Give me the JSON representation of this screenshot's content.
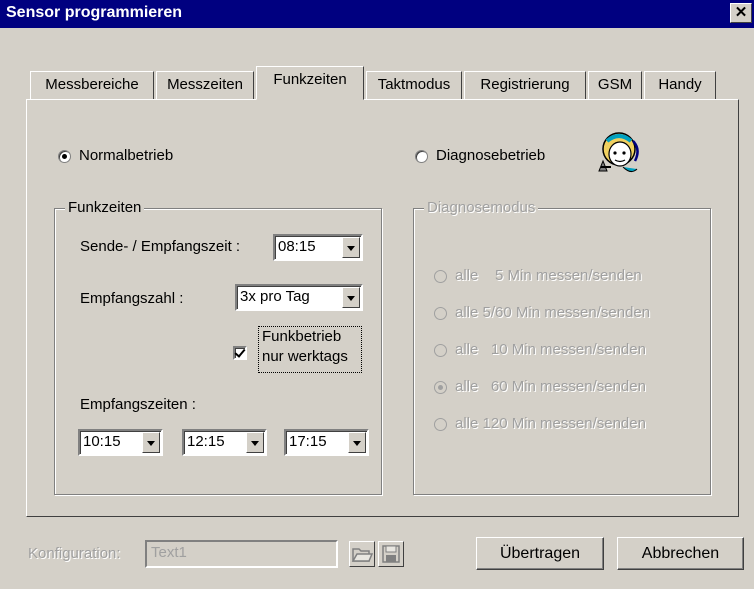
{
  "window": {
    "title": "Sensor programmieren",
    "close_label": "✕"
  },
  "tabs": [
    {
      "label": "Messbereiche",
      "active": false
    },
    {
      "label": "Messzeiten",
      "active": false
    },
    {
      "label": "Funkzeiten",
      "active": true
    },
    {
      "label": "Taktmodus",
      "active": false
    },
    {
      "label": "Registrierung",
      "active": false
    },
    {
      "label": "GSM",
      "active": false
    },
    {
      "label": "Handy",
      "active": false
    }
  ],
  "mode": {
    "normal_label": "Normalbetrieb",
    "normal_selected": true,
    "diagnose_label": "Diagnosebetrieb",
    "diagnose_selected": false,
    "diagnose_icon": "doctor-icon"
  },
  "funkzeiten": {
    "group_label": "Funkzeiten",
    "send_label": "Sende- / Empfangszeit :",
    "send_value": "08:15",
    "count_label": "Empfangszahl :",
    "count_value": "3x pro Tag",
    "workdays_label_1": "Funkbetrieb",
    "workdays_label_2": "nur werktags",
    "workdays_checked": true,
    "times_label": "Empfangszeiten :",
    "times": [
      "10:15",
      "12:15",
      "17:15"
    ]
  },
  "diagnosemodus": {
    "group_label": "Diagnosemodus",
    "options": [
      {
        "label": "alle    5 Min messen/senden",
        "selected": false
      },
      {
        "label": "alle 5/60 Min messen/senden",
        "selected": false
      },
      {
        "label": "alle   10 Min messen/senden",
        "selected": false
      },
      {
        "label": "alle   60 Min messen/senden",
        "selected": true
      },
      {
        "label": "alle 120 Min messen/senden",
        "selected": false
      }
    ]
  },
  "footer": {
    "config_label": "Konfiguration:",
    "config_value": "Text1",
    "open_icon": "open-folder-icon",
    "save_icon": "save-disk-icon",
    "transfer_label": "Übertragen",
    "cancel_label": "Abbrechen"
  }
}
